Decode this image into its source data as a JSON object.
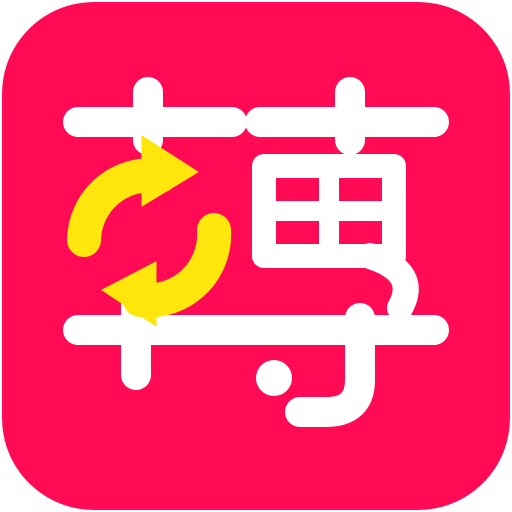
{
  "app_icon": {
    "icon_name": "zhuan-app-icon",
    "glyph": "轉",
    "colors": {
      "background": "#ff0a55",
      "glyph": "#ffffff",
      "arrows": "#ffe60c"
    }
  }
}
